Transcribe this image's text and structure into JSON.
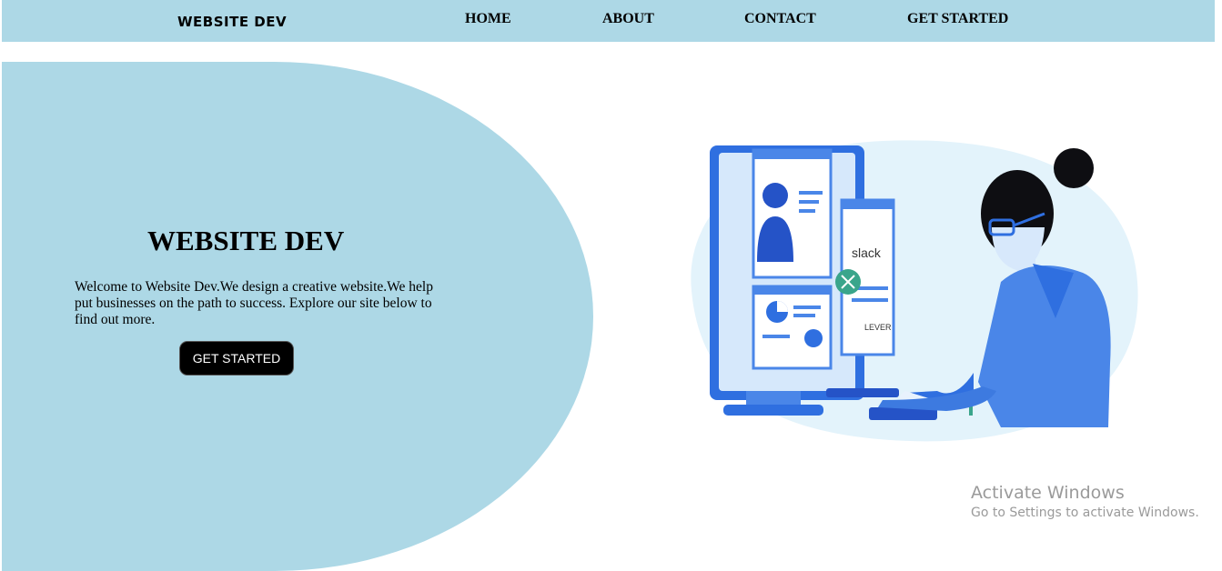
{
  "navbar": {
    "logo": "WEBSITE DEV",
    "links": [
      "HOME",
      "ABOUT",
      "CONTACT",
      "GET STARTED"
    ]
  },
  "hero": {
    "title": "WEBSITE DEV",
    "text": "Welcome to Website Dev.We design a creative website.We help put businesses on the path to success. Explore our site below to find out more.",
    "button": "GET STARTED"
  },
  "illustration": {
    "app_labels": [
      "slack",
      "LEVER"
    ]
  },
  "watermark": {
    "title": "Activate Windows",
    "subtitle": "Go to Settings to activate Windows."
  },
  "colors": {
    "accent": "#add8e6",
    "illustration_blue": "#2f6fe0",
    "illustration_light": "#e3f3fb"
  }
}
